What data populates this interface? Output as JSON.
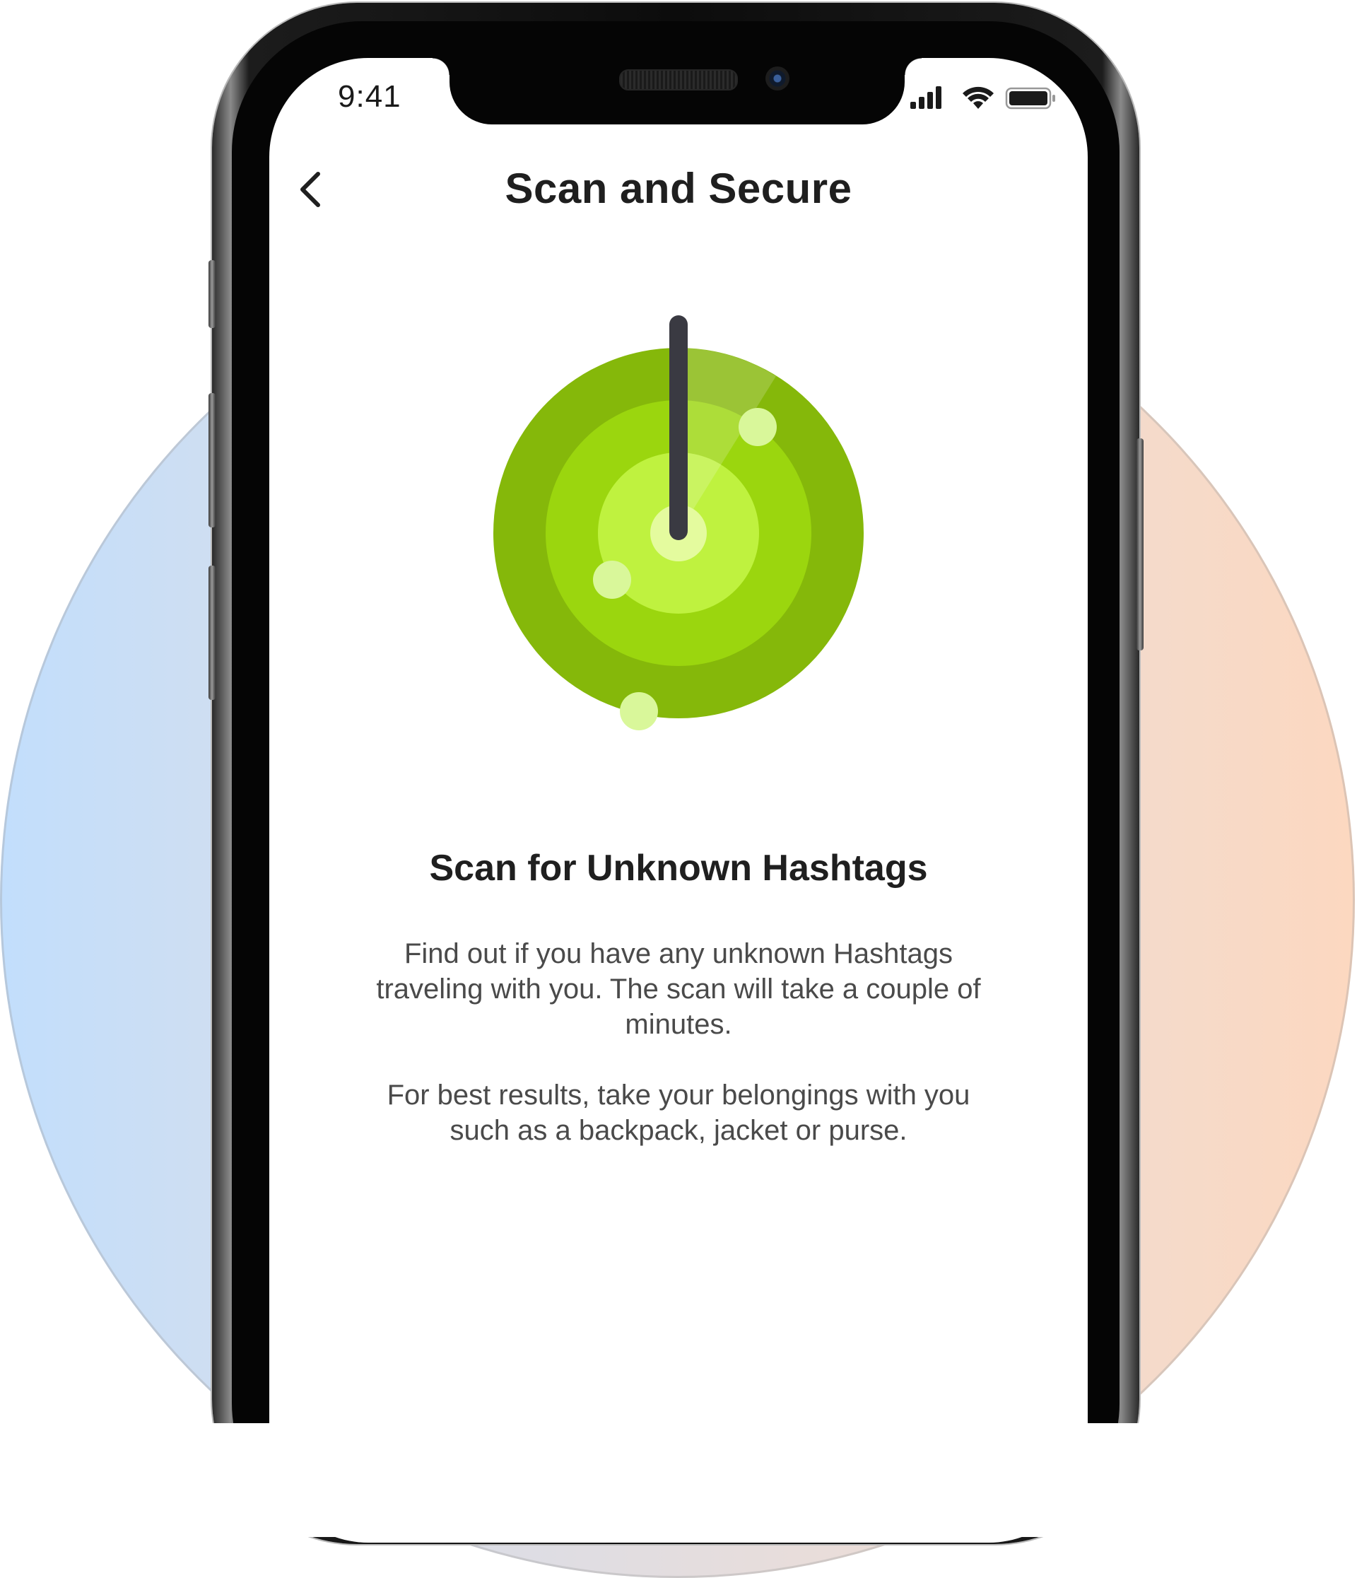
{
  "status_bar": {
    "time": "9:41",
    "icons": [
      "cellular-signal-icon",
      "wifi-icon",
      "battery-icon"
    ]
  },
  "nav": {
    "back_icon": "chevron-left-icon",
    "title": "Scan and Secure"
  },
  "illustration": {
    "name": "radar-scanner",
    "colors": {
      "outer": "#85b80a",
      "mid": "#9bd60e",
      "inner": "#bff23f",
      "needle": "#3a3a42",
      "blip": "#d9f79a"
    }
  },
  "content": {
    "heading": "Scan for Unknown Hashtags",
    "paragraph_1": "Find out if you have any unknown Hashtags traveling with you. The scan will take a couple of minutes.",
    "paragraph_2": "For best results, take your belongings with you such as a backpack, jacket or purse."
  },
  "theme": {
    "background_gradient": [
      "#c2defc",
      "#fcd8c0"
    ],
    "text_primary": "#1f1f1f",
    "text_secondary": "#4a4a4a"
  }
}
